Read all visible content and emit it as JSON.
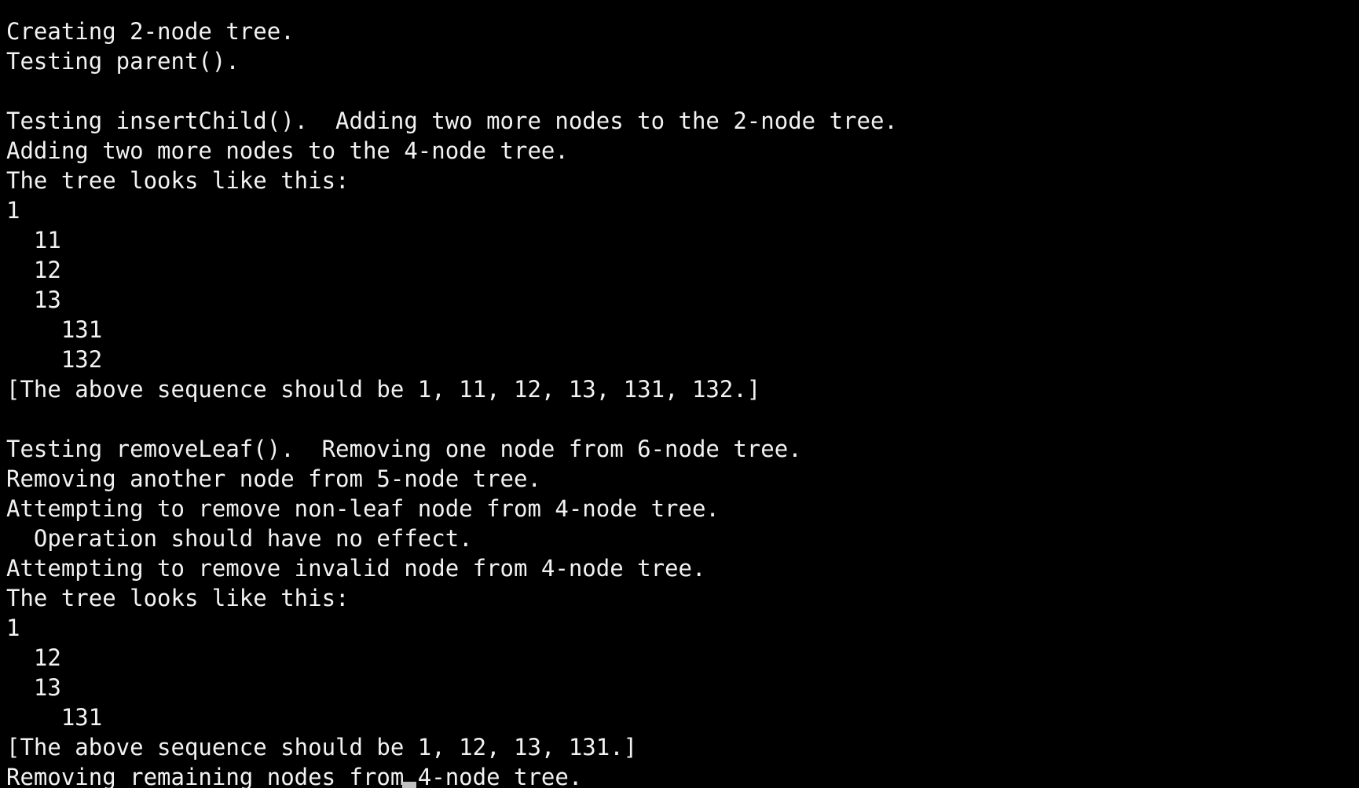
{
  "terminal": {
    "background": "#000000",
    "foreground": "#f2f2f2",
    "lines": [
      "Creating 2-node tree.",
      "Testing parent().",
      "",
      "Testing insertChild().  Adding two more nodes to the 2-node tree.",
      "Adding two more nodes to the 4-node tree.",
      "The tree looks like this:",
      "1",
      "  11",
      "  12",
      "  13",
      "    131",
      "    132",
      "[The above sequence should be 1, 11, 12, 13, 131, 132.]",
      "",
      "Testing removeLeaf().  Removing one node from 6-node tree.",
      "Removing another node from 5-node tree.",
      "Attempting to remove non-leaf node from 4-node tree.",
      "  Operation should have no effect.",
      "Attempting to remove invalid node from 4-node tree.",
      "The tree looks like this:",
      "1",
      "  12",
      "  13",
      "    131",
      "[The above sequence should be 1, 12, 13, 131.]",
      "Removing remaining nodes from 4-node tree."
    ]
  }
}
